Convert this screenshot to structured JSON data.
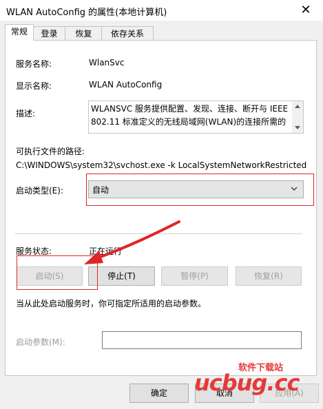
{
  "window": {
    "title": "WLAN AutoConfig 的属性(本地计算机)",
    "close_glyph": "✕"
  },
  "tabs": [
    {
      "label": "常规"
    },
    {
      "label": "登录"
    },
    {
      "label": "恢复"
    },
    {
      "label": "依存关系"
    }
  ],
  "general": {
    "service_name_label": "服务名称:",
    "service_name": "WlanSvc",
    "display_name_label": "显示名称:",
    "display_name": "WLAN AutoConfig",
    "description_label": "描述:",
    "description": "WLANSVC 服务提供配置、发现、连接、断开与 IEEE 802.11 标准定义的无线局域网(WLAN)的连接所需的",
    "exe_path_label": "可执行文件的路径:",
    "exe_path": "C:\\WINDOWS\\system32\\svchost.exe -k LocalSystemNetworkRestricted",
    "startup_type_label": "启动类型(E):",
    "startup_type": "自动",
    "service_status_label": "服务状态:",
    "service_status": "正在运行",
    "buttons": {
      "start": "启动(S)",
      "stop": "停止(T)",
      "pause": "暂停(P)",
      "resume": "恢复(R)"
    },
    "hint": "当从此处启动服务时，你可指定所适用的启动参数。",
    "start_params_label": "启动参数(M):",
    "start_params_value": ""
  },
  "footer": {
    "ok": "确定",
    "cancel": "取消",
    "apply": "应用(A)"
  },
  "watermark": {
    "line1": "软件下载站",
    "line2": "ucbug.cc"
  },
  "colors": {
    "annotation_red": "#e0242a"
  }
}
